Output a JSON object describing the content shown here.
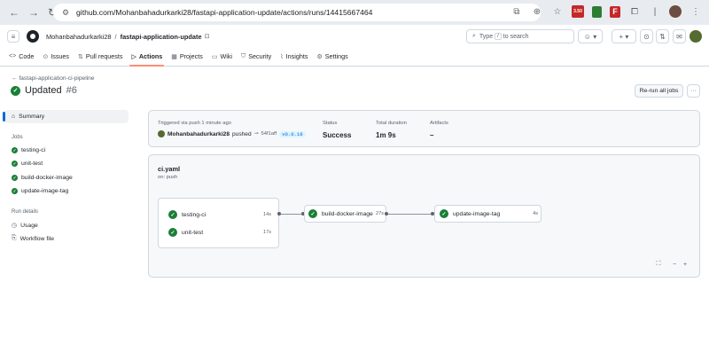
{
  "browser": {
    "url": "github.com/Mohanbahadurkarki28/fastapi-application-update/actions/runs/14415667464",
    "ext_badge": "3.50"
  },
  "header": {
    "owner": "Mohanbahadurkarki28",
    "separator": "/",
    "repo": "fastapi-application-update",
    "search_prefix": "Type",
    "search_key": "/",
    "search_suffix": "to search"
  },
  "tabs": [
    {
      "label": "Code",
      "icon": "<>"
    },
    {
      "label": "Issues",
      "icon": "⊙"
    },
    {
      "label": "Pull requests",
      "icon": "⇅"
    },
    {
      "label": "Actions",
      "icon": "▷"
    },
    {
      "label": "Projects",
      "icon": "▦"
    },
    {
      "label": "Wiki",
      "icon": "▭"
    },
    {
      "label": "Security",
      "icon": "⛉"
    },
    {
      "label": "Insights",
      "icon": "⌇"
    },
    {
      "label": "Settings",
      "icon": "⚙"
    }
  ],
  "run": {
    "back_link": "fastapi-application-ci-pipeline",
    "title": "Updated",
    "number": "#6",
    "rerun_label": "Re-run all jobs"
  },
  "sidebar": {
    "summary_label": "Summary",
    "jobs_heading": "Jobs",
    "jobs": [
      "testing-ci",
      "unit-test",
      "build-docker-image",
      "update-image-tag"
    ],
    "details_heading": "Run details",
    "details": [
      "Usage",
      "Workflow file"
    ]
  },
  "summary_card": {
    "trigger_text": "Triggered via push 1 minute ago",
    "actor": "Mohanbahadurkarki28",
    "action": "pushed",
    "commit_sha": "54f1aff",
    "tag": "v0.0.18",
    "status_label": "Status",
    "status_value": "Success",
    "duration_label": "Total duration",
    "duration_value": "1m 9s",
    "artifacts_label": "Artifacts",
    "artifacts_value": "–"
  },
  "workflow": {
    "file": "ci.yaml",
    "trigger": "on: push",
    "jobs": [
      {
        "name": "testing-ci",
        "duration": "14s"
      },
      {
        "name": "unit-test",
        "duration": "17s"
      },
      {
        "name": "build-docker-image",
        "duration": "27s"
      },
      {
        "name": "update-image-tag",
        "duration": "4s"
      }
    ],
    "zoom_out": "−",
    "zoom_in": "+"
  },
  "colors": {
    "success": "#1a7f37",
    "active_tab_underline": "#fd8c73",
    "link": "#0969da"
  }
}
